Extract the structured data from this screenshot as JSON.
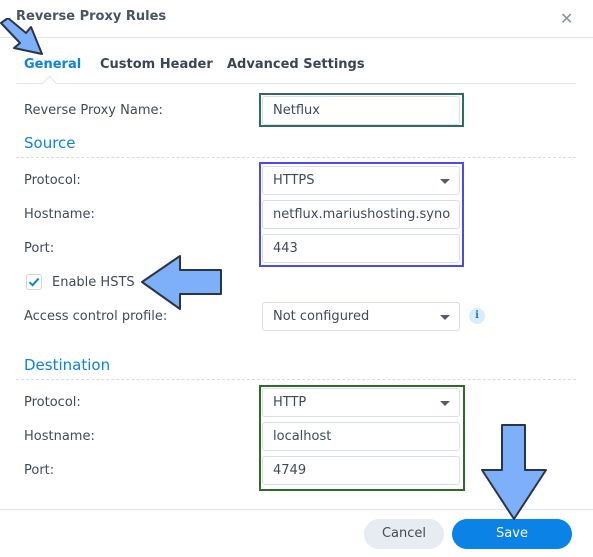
{
  "dialog": {
    "title": "Reverse Proxy Rules",
    "close_icon": "close-icon"
  },
  "tabs": [
    {
      "label": "General",
      "active": true
    },
    {
      "label": "Custom Header",
      "active": false
    },
    {
      "label": "Advanced Settings",
      "active": false
    }
  ],
  "general": {
    "name_label": "Reverse Proxy Name:",
    "name_value": "Netflux"
  },
  "source": {
    "heading": "Source",
    "protocol_label": "Protocol:",
    "protocol_value": "HTTPS",
    "hostname_label": "Hostname:",
    "hostname_value": "netflux.mariushosting.syno",
    "port_label": "Port:",
    "port_value": "443",
    "hsts_label": "Enable HSTS",
    "hsts_checked": true,
    "access_label": "Access control profile:",
    "access_value": "Not configured",
    "info_icon": "i"
  },
  "destination": {
    "heading": "Destination",
    "protocol_label": "Protocol:",
    "protocol_value": "HTTP",
    "hostname_label": "Hostname:",
    "hostname_value": "localhost",
    "port_label": "Port:",
    "port_value": "4749"
  },
  "footer": {
    "cancel_label": "Cancel",
    "save_label": "Save"
  },
  "annotations": {
    "arrow_color": "#7eb0fa",
    "name_box_color": "#2f6b62",
    "source_box_color": "#4a4af0",
    "destination_box_color": "#2e6b2a"
  }
}
